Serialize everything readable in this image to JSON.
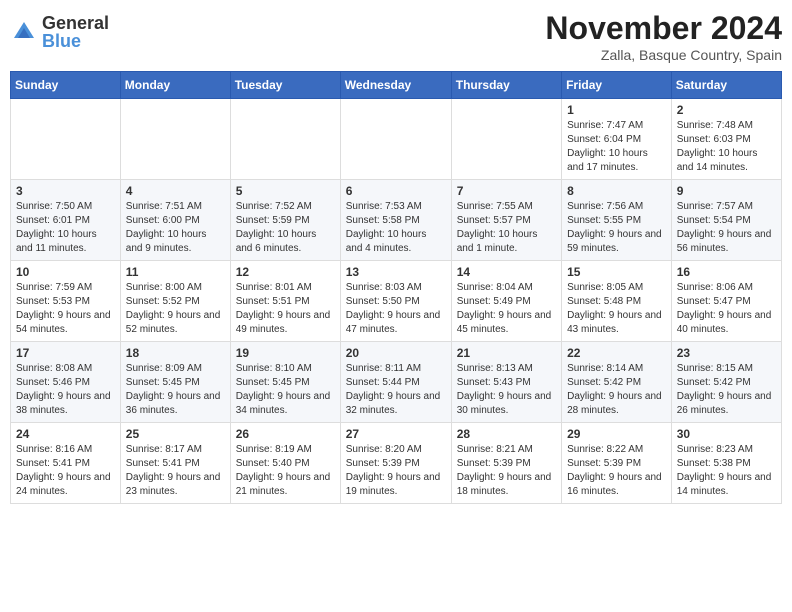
{
  "logo": {
    "general": "General",
    "blue": "Blue"
  },
  "title": "November 2024",
  "location": "Zalla, Basque Country, Spain",
  "weekdays": [
    "Sunday",
    "Monday",
    "Tuesday",
    "Wednesday",
    "Thursday",
    "Friday",
    "Saturday"
  ],
  "weeks": [
    [
      {
        "day": "",
        "info": ""
      },
      {
        "day": "",
        "info": ""
      },
      {
        "day": "",
        "info": ""
      },
      {
        "day": "",
        "info": ""
      },
      {
        "day": "",
        "info": ""
      },
      {
        "day": "1",
        "info": "Sunrise: 7:47 AM\nSunset: 6:04 PM\nDaylight: 10 hours and 17 minutes."
      },
      {
        "day": "2",
        "info": "Sunrise: 7:48 AM\nSunset: 6:03 PM\nDaylight: 10 hours and 14 minutes."
      }
    ],
    [
      {
        "day": "3",
        "info": "Sunrise: 7:50 AM\nSunset: 6:01 PM\nDaylight: 10 hours and 11 minutes."
      },
      {
        "day": "4",
        "info": "Sunrise: 7:51 AM\nSunset: 6:00 PM\nDaylight: 10 hours and 9 minutes."
      },
      {
        "day": "5",
        "info": "Sunrise: 7:52 AM\nSunset: 5:59 PM\nDaylight: 10 hours and 6 minutes."
      },
      {
        "day": "6",
        "info": "Sunrise: 7:53 AM\nSunset: 5:58 PM\nDaylight: 10 hours and 4 minutes."
      },
      {
        "day": "7",
        "info": "Sunrise: 7:55 AM\nSunset: 5:57 PM\nDaylight: 10 hours and 1 minute."
      },
      {
        "day": "8",
        "info": "Sunrise: 7:56 AM\nSunset: 5:55 PM\nDaylight: 9 hours and 59 minutes."
      },
      {
        "day": "9",
        "info": "Sunrise: 7:57 AM\nSunset: 5:54 PM\nDaylight: 9 hours and 56 minutes."
      }
    ],
    [
      {
        "day": "10",
        "info": "Sunrise: 7:59 AM\nSunset: 5:53 PM\nDaylight: 9 hours and 54 minutes."
      },
      {
        "day": "11",
        "info": "Sunrise: 8:00 AM\nSunset: 5:52 PM\nDaylight: 9 hours and 52 minutes."
      },
      {
        "day": "12",
        "info": "Sunrise: 8:01 AM\nSunset: 5:51 PM\nDaylight: 9 hours and 49 minutes."
      },
      {
        "day": "13",
        "info": "Sunrise: 8:03 AM\nSunset: 5:50 PM\nDaylight: 9 hours and 47 minutes."
      },
      {
        "day": "14",
        "info": "Sunrise: 8:04 AM\nSunset: 5:49 PM\nDaylight: 9 hours and 45 minutes."
      },
      {
        "day": "15",
        "info": "Sunrise: 8:05 AM\nSunset: 5:48 PM\nDaylight: 9 hours and 43 minutes."
      },
      {
        "day": "16",
        "info": "Sunrise: 8:06 AM\nSunset: 5:47 PM\nDaylight: 9 hours and 40 minutes."
      }
    ],
    [
      {
        "day": "17",
        "info": "Sunrise: 8:08 AM\nSunset: 5:46 PM\nDaylight: 9 hours and 38 minutes."
      },
      {
        "day": "18",
        "info": "Sunrise: 8:09 AM\nSunset: 5:45 PM\nDaylight: 9 hours and 36 minutes."
      },
      {
        "day": "19",
        "info": "Sunrise: 8:10 AM\nSunset: 5:45 PM\nDaylight: 9 hours and 34 minutes."
      },
      {
        "day": "20",
        "info": "Sunrise: 8:11 AM\nSunset: 5:44 PM\nDaylight: 9 hours and 32 minutes."
      },
      {
        "day": "21",
        "info": "Sunrise: 8:13 AM\nSunset: 5:43 PM\nDaylight: 9 hours and 30 minutes."
      },
      {
        "day": "22",
        "info": "Sunrise: 8:14 AM\nSunset: 5:42 PM\nDaylight: 9 hours and 28 minutes."
      },
      {
        "day": "23",
        "info": "Sunrise: 8:15 AM\nSunset: 5:42 PM\nDaylight: 9 hours and 26 minutes."
      }
    ],
    [
      {
        "day": "24",
        "info": "Sunrise: 8:16 AM\nSunset: 5:41 PM\nDaylight: 9 hours and 24 minutes."
      },
      {
        "day": "25",
        "info": "Sunrise: 8:17 AM\nSunset: 5:41 PM\nDaylight: 9 hours and 23 minutes."
      },
      {
        "day": "26",
        "info": "Sunrise: 8:19 AM\nSunset: 5:40 PM\nDaylight: 9 hours and 21 minutes."
      },
      {
        "day": "27",
        "info": "Sunrise: 8:20 AM\nSunset: 5:39 PM\nDaylight: 9 hours and 19 minutes."
      },
      {
        "day": "28",
        "info": "Sunrise: 8:21 AM\nSunset: 5:39 PM\nDaylight: 9 hours and 18 minutes."
      },
      {
        "day": "29",
        "info": "Sunrise: 8:22 AM\nSunset: 5:39 PM\nDaylight: 9 hours and 16 minutes."
      },
      {
        "day": "30",
        "info": "Sunrise: 8:23 AM\nSunset: 5:38 PM\nDaylight: 9 hours and 14 minutes."
      }
    ]
  ]
}
